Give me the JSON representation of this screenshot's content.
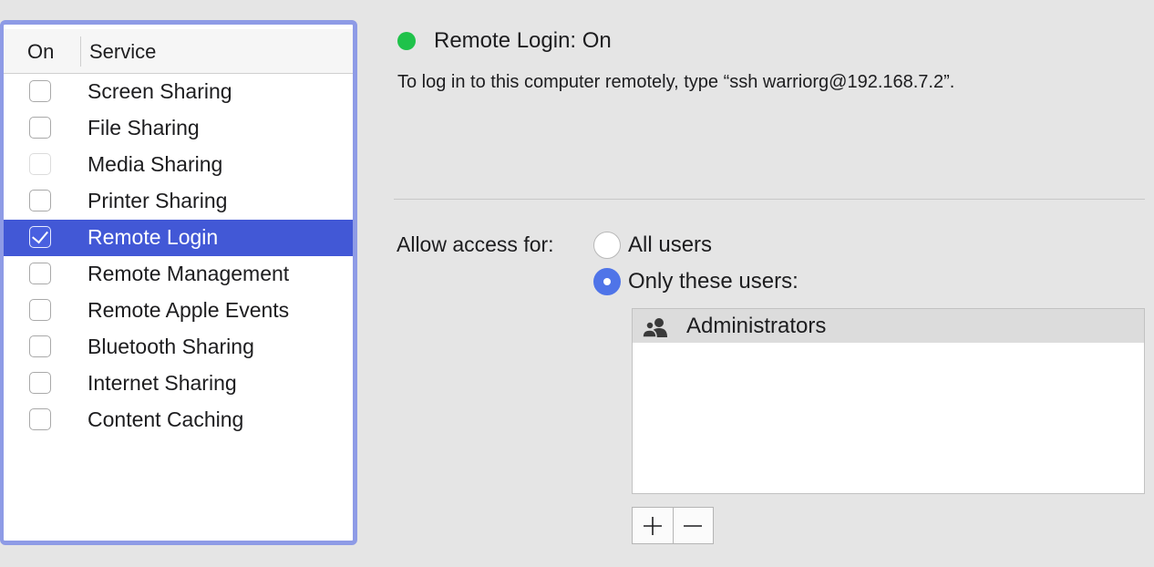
{
  "services": {
    "header": {
      "on": "On",
      "service": "Service"
    },
    "items": [
      {
        "label": "Screen Sharing",
        "checked": false,
        "enabled": true
      },
      {
        "label": "File Sharing",
        "checked": false,
        "enabled": true
      },
      {
        "label": "Media Sharing",
        "checked": false,
        "enabled": false
      },
      {
        "label": "Printer Sharing",
        "checked": false,
        "enabled": true
      },
      {
        "label": "Remote Login",
        "checked": true,
        "enabled": true,
        "selected": true
      },
      {
        "label": "Remote Management",
        "checked": false,
        "enabled": true
      },
      {
        "label": "Remote Apple Events",
        "checked": false,
        "enabled": true
      },
      {
        "label": "Bluetooth Sharing",
        "checked": false,
        "enabled": true
      },
      {
        "label": "Internet Sharing",
        "checked": false,
        "enabled": true
      },
      {
        "label": "Content Caching",
        "checked": false,
        "enabled": true
      }
    ],
    "selection_color": "#4258d6",
    "focus_ring_color": "#8e9be6"
  },
  "detail": {
    "status_title": "Remote Login: On",
    "status_color": "#1fc24a",
    "description": "To log in to this computer remotely, type “ssh warriorg@192.168.7.2”.",
    "access_label": "Allow access for:",
    "options": {
      "all": "All users",
      "only": "Only these users:",
      "selected": "only"
    },
    "users": [
      {
        "name": "Administrators",
        "icon": "group-icon"
      }
    ],
    "buttons": {
      "add": "add-icon",
      "remove": "remove-icon"
    }
  }
}
